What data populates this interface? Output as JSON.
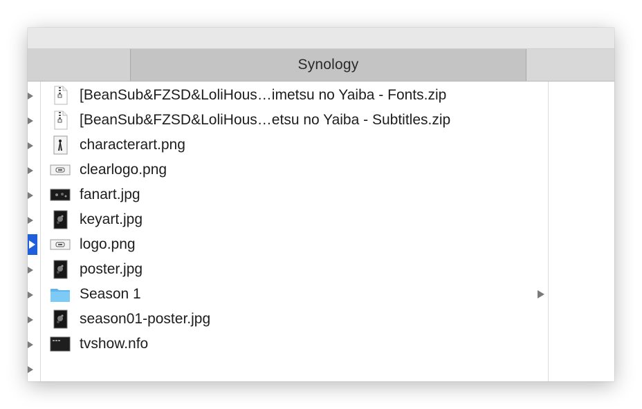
{
  "window": {
    "tab_title": "Synology"
  },
  "files": [
    {
      "name": "[BeanSub&FZSD&LoliHous…imetsu no Yaiba - Fonts.zip",
      "icon": "zip-file-icon"
    },
    {
      "name": "[BeanSub&FZSD&LoliHous…etsu no Yaiba - Subtitles.zip",
      "icon": "zip-file-icon"
    },
    {
      "name": "characterart.png",
      "icon": "image-thumbnail-icon"
    },
    {
      "name": "clearlogo.png",
      "icon": "logo-thumbnail-icon"
    },
    {
      "name": "fanart.jpg",
      "icon": "image-thumbnail-icon"
    },
    {
      "name": "keyart.jpg",
      "icon": "image-thumbnail-icon"
    },
    {
      "name": "logo.png",
      "icon": "logo-thumbnail-icon"
    },
    {
      "name": "poster.jpg",
      "icon": "image-thumbnail-icon"
    },
    {
      "name": "Season 1",
      "icon": "folder-icon"
    },
    {
      "name": "season01-poster.jpg",
      "icon": "image-thumbnail-icon"
    },
    {
      "name": "tvshow.nfo",
      "icon": "document-icon"
    }
  ],
  "colors": {
    "selection": "#1f5fdb",
    "folder": "#6cc0f0",
    "tab_active": "#c4c4c4"
  }
}
